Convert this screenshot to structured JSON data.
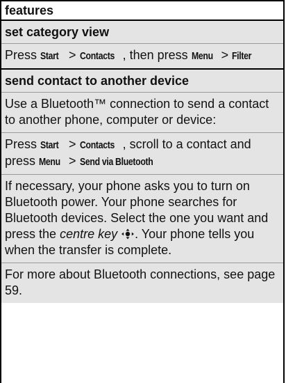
{
  "table": {
    "header": "features",
    "sections": [
      {
        "title": "set category view",
        "instruction": {
          "prefix": "Press",
          "key1": "Start",
          "sep1": ">",
          "key2": "Contacts",
          "mid": ", then press",
          "key3": "Menu",
          "sep2": ">",
          "key4": "Filter"
        }
      },
      {
        "title": "send contact to another device",
        "para1": "Use a Bluetooth™ connection to send a contact to another phone, computer or device:",
        "instruction": {
          "prefix": "Press",
          "key1": "Start",
          "sep1": ">",
          "key2": "Contacts",
          "mid": ", scroll to a contact and press",
          "key3": "Menu",
          "sep2": ">",
          "key4": "Send via Bluetooth"
        },
        "para3_before": "If necessary, your phone asks you to turn on Bluetooth power. Your phone searches for Bluetooth devices. Select the one you want and press the",
        "para3_key": "centre key",
        "para3_after": ". Your phone tells you when the transfer is complete.",
        "para4": "For more about Bluetooth connections, see page 59."
      }
    ]
  }
}
